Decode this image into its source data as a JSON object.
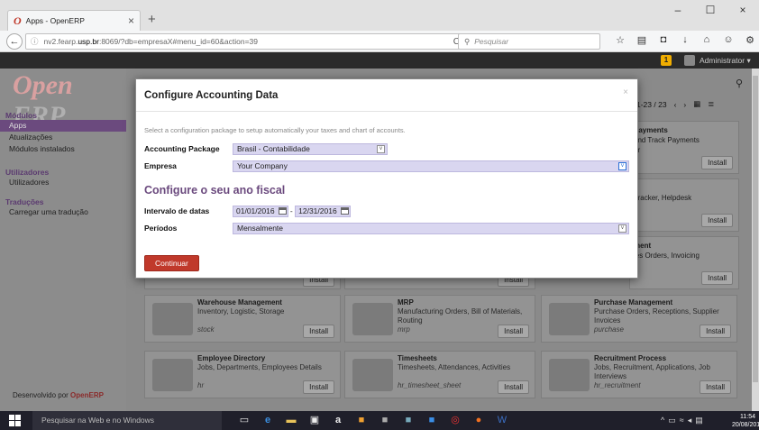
{
  "browser": {
    "tab_title": "Apps - OpenERP",
    "tab_logo": "O",
    "url_prefix": "nv2.fearp.",
    "url_host": "usp.br",
    "url_rest": ":8069/?db=empresaX#menu_id=60&action=39",
    "search_placeholder": "Pesquisar"
  },
  "odoo_bar": {
    "notification_count": "1",
    "user": "Administrator"
  },
  "sidebar": {
    "brand": "Open",
    "brand_suffix": "ERP",
    "sections": [
      {
        "heading": "Módulos",
        "items": [
          "Apps",
          "Atualizações",
          "Módulos instalados"
        ]
      },
      {
        "heading": "Utilizadores",
        "items": [
          "Utilizadores"
        ]
      },
      {
        "heading": "Traduções",
        "items": [
          "Carregar uma tradução"
        ]
      }
    ],
    "footer_prefix": "Desenvolvido por ",
    "footer_brand": "OpenERP"
  },
  "pager": {
    "range": "1-23 / 23"
  },
  "partial_cards": {
    "payments_title": "Payments",
    "payments_desc": "and Track Payments",
    "payments_desc2": "er",
    "helpdesk_desc": "Tracker, Helpdesk",
    "sales_title": "ment",
    "sales_desc": "les Orders, Invoicing"
  },
  "cards": [
    {
      "name": "Warehouse Management",
      "desc": "Inventory, Logistic, Storage",
      "tech": "stock",
      "install": "Install"
    },
    {
      "name": "MRP",
      "desc": "Manufacturing Orders, Bill of Materials, Routing",
      "tech": "mrp",
      "install": "Install"
    },
    {
      "name": "Purchase Management",
      "desc": "Purchase Orders, Receptions, Supplier Invoices",
      "tech": "purchase",
      "install": "Install"
    },
    {
      "name": "Employee Directory",
      "desc": "Jobs, Departments, Employees Details",
      "tech": "hr",
      "install": "Install"
    },
    {
      "name": "Timesheets",
      "desc": "Timesheets, Attendances, Activities",
      "tech": "hr_timesheet_sheet",
      "install": "Install"
    },
    {
      "name": "Recruitment Process",
      "desc": "Jobs, Recruitment, Applications, Job Interviews",
      "tech": "hr_recruitment",
      "install": "Install"
    }
  ],
  "install_label": "Install",
  "modal": {
    "title": "Configure Accounting Data",
    "close": "×",
    "help": "Select a configuration package to setup automatically your taxes and chart of accounts.",
    "accounting_package_label": "Accounting Package",
    "accounting_package_value": "Brasil - Contabilidade",
    "empresa_label": "Empresa",
    "empresa_value": "Your Company",
    "fiscal_title": "Configure o seu ano fiscal",
    "date_range_label": "Intervalo de datas",
    "date_from": "01/01/2016",
    "date_to": "12/31/2016",
    "date_sep": "-",
    "periods_label": "Períodos",
    "periods_value": "Mensalmente",
    "continue_button": "Continuar"
  },
  "taskbar": {
    "search_placeholder": "Pesquisar na Web e no Windows",
    "time": "11:54",
    "date": "20/08/2016"
  }
}
